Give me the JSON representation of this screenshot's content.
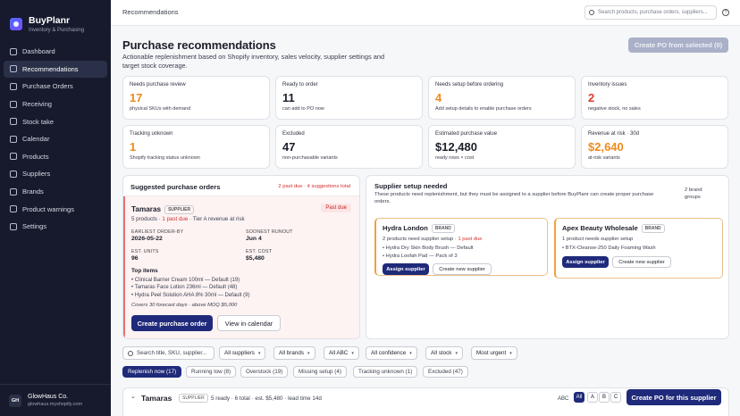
{
  "app": {
    "name": "BuyPlanr",
    "subtitle": "Inventory & Purchasing"
  },
  "nav": [
    {
      "label": "Dashboard",
      "icon": "dashboard-icon"
    },
    {
      "label": "Recommendations",
      "icon": "recommendations-icon",
      "active": true
    },
    {
      "label": "Purchase Orders",
      "icon": "purchase-orders-icon"
    },
    {
      "label": "Receiving",
      "icon": "receiving-icon"
    },
    {
      "label": "Stock take",
      "icon": "stock-take-icon"
    },
    {
      "label": "Calendar",
      "icon": "calendar-icon"
    },
    {
      "label": "Products",
      "icon": "products-icon"
    },
    {
      "label": "Suppliers",
      "icon": "suppliers-icon"
    },
    {
      "label": "Brands",
      "icon": "brands-icon"
    },
    {
      "label": "Product warnings",
      "icon": "warning-icon"
    },
    {
      "label": "Settings",
      "icon": "settings-icon"
    }
  ],
  "account": {
    "initials": "GH",
    "name": "GlowHaus Co.",
    "domain": "glowhaus.myshopify.com"
  },
  "topbar": {
    "breadcrumb": "Recommendations",
    "search_placeholder": "Search products, purchase orders, suppliers..."
  },
  "page": {
    "title": "Purchase recommendations",
    "subtitle": "Actionable replenishment based on Shopify inventory, sales velocity, supplier settings and target stock coverage.",
    "create_po_selected": "Create PO from selected (0)"
  },
  "stats": [
    {
      "label": "Needs purchase review",
      "value": "17",
      "note": "physical SKUs with demand",
      "color": "orange"
    },
    {
      "label": "Ready to order",
      "value": "11",
      "note": "can add to PO now",
      "color": "dark"
    },
    {
      "label": "Needs setup before ordering",
      "value": "4",
      "note": "Add setup details to enable purchase orders",
      "color": "orange"
    },
    {
      "label": "Inventory issues",
      "value": "2",
      "note": "negative stock, no sales",
      "color": "red"
    },
    {
      "label": "Tracking unknown",
      "value": "1",
      "note": "Shopify tracking status unknown",
      "color": "orange"
    },
    {
      "label": "Excluded",
      "value": "47",
      "note": "non-purchasable variants",
      "color": "dark"
    },
    {
      "label": "Estimated purchase value",
      "value": "$12,480",
      "note": "ready rows × cost",
      "color": "dark"
    },
    {
      "label": "Revenue at risk · 30d",
      "value": "$2,640",
      "note": "at-risk variants",
      "color": "orange"
    }
  ],
  "suggested": {
    "title": "Suggested purchase orders",
    "summary": "2 past due · 4 suggestions total",
    "supplier": "Tamaras",
    "supplier_badge": "SUPPLIER",
    "products": "5 products · ",
    "past_due_text": "1 past due",
    "tier": " · Tier A revenue at risk",
    "status_badge": "Past due",
    "earliest_label": "EARLIEST ORDER-BY",
    "earliest_value": "2026-05-22",
    "runout_label": "SOONEST RUNOUT",
    "runout_value": "Jun 4",
    "units_label": "EST. UNITS",
    "units_value": "96",
    "cost_label": "EST. COST",
    "cost_value": "$5,480",
    "top_items_label": "Top items",
    "top_items": [
      "Clinical Barrier Cream 100ml — Default (19)",
      "Tamaras Face Lotion 236ml — Default (48)",
      "Hydra Peel Solution AHA 8% 30ml — Default (9)"
    ],
    "coverage": "Covers 30 forecast days · above MOQ $5,000",
    "create_button": "Create purchase order",
    "calendar_button": "View in calendar"
  },
  "supplier_setup": {
    "title": "Supplier setup needed",
    "description": "These products need replenishment, but they must be assigned to a supplier before BuyPlanr can create proper purchase orders.",
    "groups": "2 brand groups",
    "cards": [
      {
        "name": "Hydra London",
        "badge": "BRAND",
        "status": "2 products need supplier setup · ",
        "past_due": "1 past due",
        "items": [
          "Hydra Dry Skin Body Brush — Default",
          "Hydra Loofah Pad — Pack of 3"
        ],
        "assign": "Assign supplier",
        "create": "Create new supplier"
      },
      {
        "name": "Apex Beauty Wholesale",
        "badge": "BRAND",
        "status": "1 product needs supplier setup",
        "past_due": "",
        "items": [
          "BTX-Cleanse-250 Daily Foaming Wash"
        ],
        "assign": "Assign supplier",
        "create": "Create new supplier"
      }
    ]
  },
  "filters": {
    "search_placeholder": "Search title, SKU, supplier...",
    "chips": [
      "All suppliers",
      "All brands",
      "All ABC",
      "All confidence",
      "All stock",
      "Most urgent"
    ]
  },
  "tabs": [
    "Replenish now (17)",
    "Running low (8)",
    "Overstock (19)",
    "Missing setup (4)",
    "Tracking unknown (1)",
    "Excluded (47)"
  ],
  "group_row": {
    "supplier": "Tamaras",
    "badge": "SUPPLIER",
    "summary": "5 ready · 6 total · est. $5,480 · lead time 14d",
    "abc_label": "ABC",
    "abc_options": [
      "All",
      "A",
      "B",
      "C"
    ],
    "create_button": "Create PO for this supplier"
  }
}
